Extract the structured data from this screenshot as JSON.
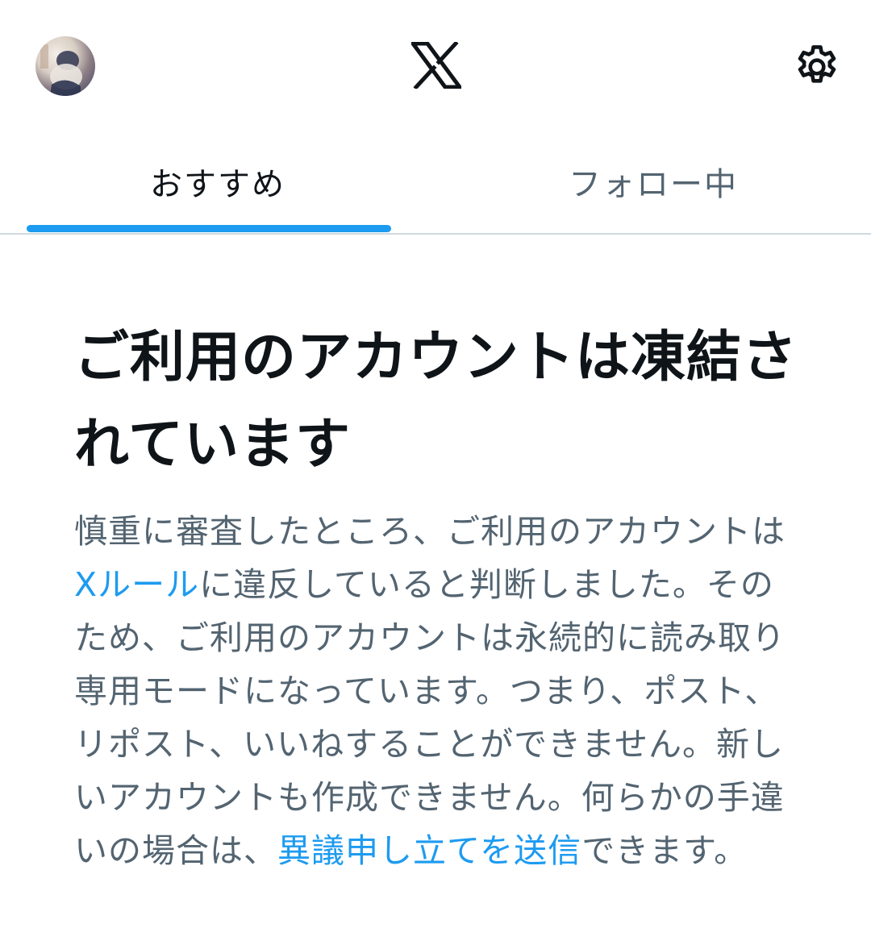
{
  "header": {
    "avatar_icon": "profile-avatar",
    "logo_icon": "x-logo-icon",
    "settings_icon": "gear-icon"
  },
  "tabs": [
    {
      "label": "おすすめ",
      "active": true
    },
    {
      "label": "フォロー中",
      "active": false
    }
  ],
  "notice": {
    "title": "ご利用のアカウントは凍結されています",
    "body_part1": "慎重に審査したところ、ご利用のアカウントは",
    "rules_link": "Xルール",
    "body_part2": "に違反していると判断しました。そのため、ご利用のアカウントは永続的に読み取り専用モードになっています。つまり、ポスト、リポスト、いいねすることができません。新しいアカウントも作成できません。何らかの手違いの場合は、",
    "appeal_link": "異議申し立てを送信",
    "body_part3": "できます。"
  },
  "colors": {
    "accent": "#1d9bf0",
    "text_primary": "#0f1419",
    "text_secondary": "#536471",
    "divider": "#cfd9de"
  }
}
